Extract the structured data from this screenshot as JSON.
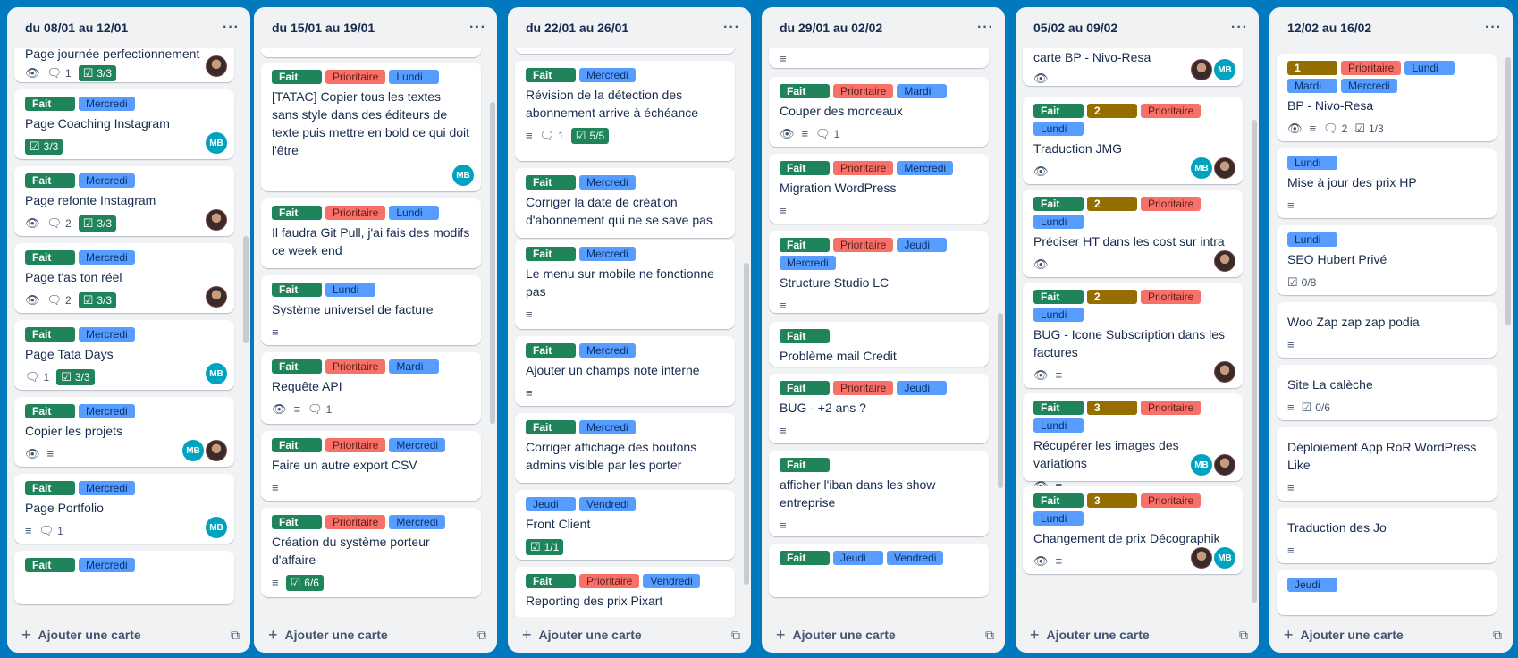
{
  "colors": {
    "board_bg": "#0079bf",
    "list_bg": "#f1f2f4",
    "done": "#1f845a",
    "priority": "#f87168",
    "day": "#579dff",
    "number": "#946f00",
    "avatar_mb": "#00a3bf"
  },
  "icons": {
    "watch": "eye-icon",
    "description": "description-icon",
    "comments": "comment-icon",
    "checklist": "checklist-icon",
    "menu": "more-icon",
    "add": "plus-icon",
    "template": "card-template-icon"
  },
  "common": {
    "add_card": "Ajouter une carte",
    "menu": "···"
  },
  "labels": {
    "done": "Fait",
    "prio": "Prioritaire",
    "lundi": "Lundi",
    "mardi": "Mardi",
    "mercredi": "Mercredi",
    "jeudi": "Jeudi",
    "vendredi": "Vendredi",
    "n1": "1",
    "n2": "2",
    "n3": "3"
  },
  "lists": [
    {
      "title": "du 08/01 au 12/01",
      "cards": [
        {
          "title": "Page journée perfectionnement",
          "comments": "1",
          "checklist": "3/3",
          "members": [
            "photo"
          ]
        },
        {
          "title": "Page Coaching Instagram",
          "checklist": "3/3",
          "members": [
            "MB"
          ]
        },
        {
          "title": "Page refonte Instagram",
          "comments": "2",
          "checklist": "3/3",
          "members": [
            "photo"
          ]
        },
        {
          "title": "Page t'as ton réel",
          "comments": "2",
          "checklist": "3/3",
          "members": [
            "photo"
          ]
        },
        {
          "title": "Page Tata Days",
          "comments": "1",
          "checklist": "3/3",
          "members": [
            "MB"
          ]
        },
        {
          "title": "Copier les projets",
          "members": [
            "MB",
            "photo"
          ]
        },
        {
          "title": "Page Portfolio",
          "comments": "1",
          "members": [
            "MB"
          ]
        }
      ]
    },
    {
      "title": "du 15/01 au 19/01",
      "cards": [
        {
          "title": "[TATAC] Copier tous les textes sans style dans des éditeurs de texte puis mettre en bold ce qui doit l'être",
          "members": [
            "MB"
          ]
        },
        {
          "title": "Il faudra Git Pull, j'ai fais des modifs ce week end"
        },
        {
          "title": "Système universel de facture"
        },
        {
          "title": "Requête API",
          "comments": "1"
        },
        {
          "title": "Faire un autre export CSV"
        },
        {
          "title": "Création du système porteur d'affaire",
          "checklist": "6/6"
        }
      ]
    },
    {
      "title": "du 22/01 au 26/01",
      "cards": [
        {
          "title": "Révision de la détection des abonnement arrive à échéance",
          "comments": "1",
          "checklist": "5/5"
        },
        {
          "title": "Corriger la date de création d'abonnement qui ne se save pas"
        },
        {
          "title": "Le menu sur mobile ne fonctionne pas"
        },
        {
          "title": "Ajouter un champs note interne"
        },
        {
          "title": "Corriger affichage des boutons admins visible par les porter"
        },
        {
          "title": "Front Client",
          "checklist": "1/1"
        },
        {
          "title": "Reporting des prix Pixart"
        }
      ]
    },
    {
      "title": "du 29/01 au 02/02",
      "cards": [
        {
          "title": "Couper des morceaux",
          "comments": "1"
        },
        {
          "title": "Migration WordPress"
        },
        {
          "title": "Structure Studio LC"
        },
        {
          "title": "Problème mail Credit"
        },
        {
          "title": "BUG - +2 ans ?"
        },
        {
          "title": "afficher l'iban dans les show entreprise"
        }
      ]
    },
    {
      "title": "05/02 au 09/02",
      "cards": [
        {
          "title": "carte BP - Nivo-Resa",
          "members": [
            "photo",
            "MB"
          ]
        },
        {
          "title": "Traduction JMG",
          "members": [
            "MB",
            "photo"
          ]
        },
        {
          "title": "Préciser HT dans les cost sur intra",
          "members": [
            "photo"
          ]
        },
        {
          "title": "BUG - Icone Subscription dans les factures",
          "members": [
            "photo"
          ]
        },
        {
          "title": "Récupérer les images des variations",
          "members": [
            "MB",
            "photo"
          ]
        },
        {
          "title": "Changement de prix Décographik",
          "members": [
            "photo",
            "MB"
          ]
        }
      ]
    },
    {
      "title": "12/02 au 16/02",
      "cards": [
        {
          "title": "BP - Nivo-Resa",
          "comments": "2",
          "checklist": "1/3"
        },
        {
          "title": "Mise à jour des prix HP"
        },
        {
          "title": "SEO Hubert Privé",
          "checklist": "0/8"
        },
        {
          "title": "Woo Zap zap zap podia"
        },
        {
          "title": "Site La calèche",
          "checklist": "0/6"
        },
        {
          "title": "Déploiement App RoR WordPress Like"
        },
        {
          "title": "Traduction des Jo"
        }
      ]
    }
  ]
}
